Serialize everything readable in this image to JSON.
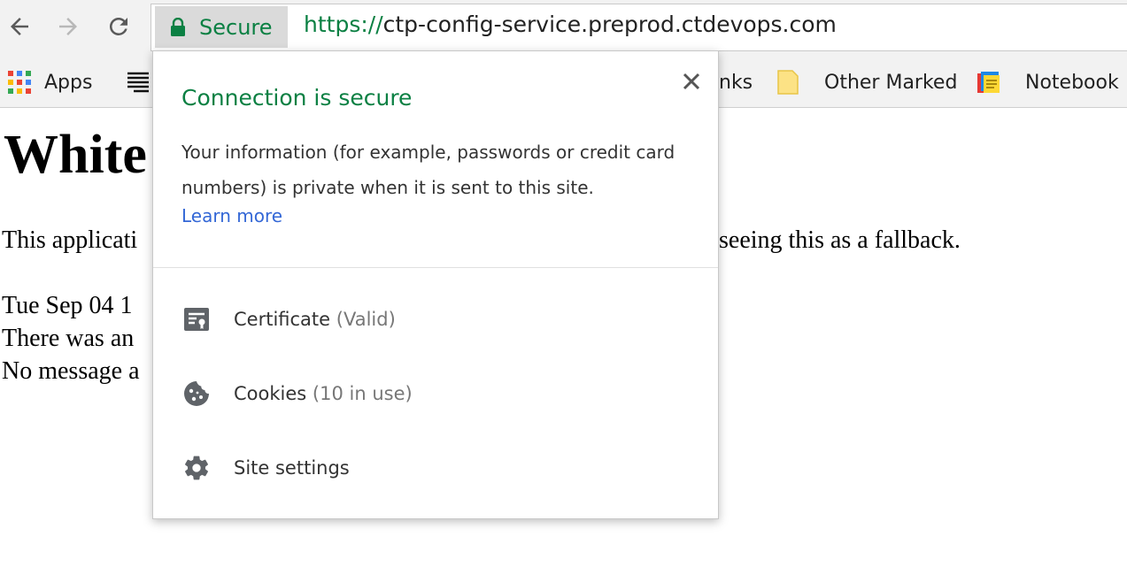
{
  "browser": {
    "secure_label": "Secure",
    "url_scheme": "https://",
    "url_rest": "ctp-config-service.preprod.ctdevops.com"
  },
  "bookmarks": {
    "apps": "Apps",
    "partial": "nks",
    "other_marked": "Other Marked",
    "notebook": "Notebook"
  },
  "page": {
    "heading": "White",
    "line1": "This applicati",
    "line1_tail": "seeing this as a fallback.",
    "line2": "Tue Sep 04 1",
    "line3": "There was an",
    "line4": "No message a"
  },
  "popup": {
    "title": "Connection is secure",
    "description": "Your information (for example, passwords or credit card numbers) is private when it is sent to this site.",
    "learn_more": "Learn more",
    "certificate_label": "Certificate",
    "certificate_status": "(Valid)",
    "cookies_label": "Cookies",
    "cookies_count": "(10 in use)",
    "site_settings_label": "Site settings"
  },
  "colors": {
    "secure_green": "#0b8043",
    "link_blue": "#3367d6",
    "toolbar_bg": "#f2f2f2"
  }
}
